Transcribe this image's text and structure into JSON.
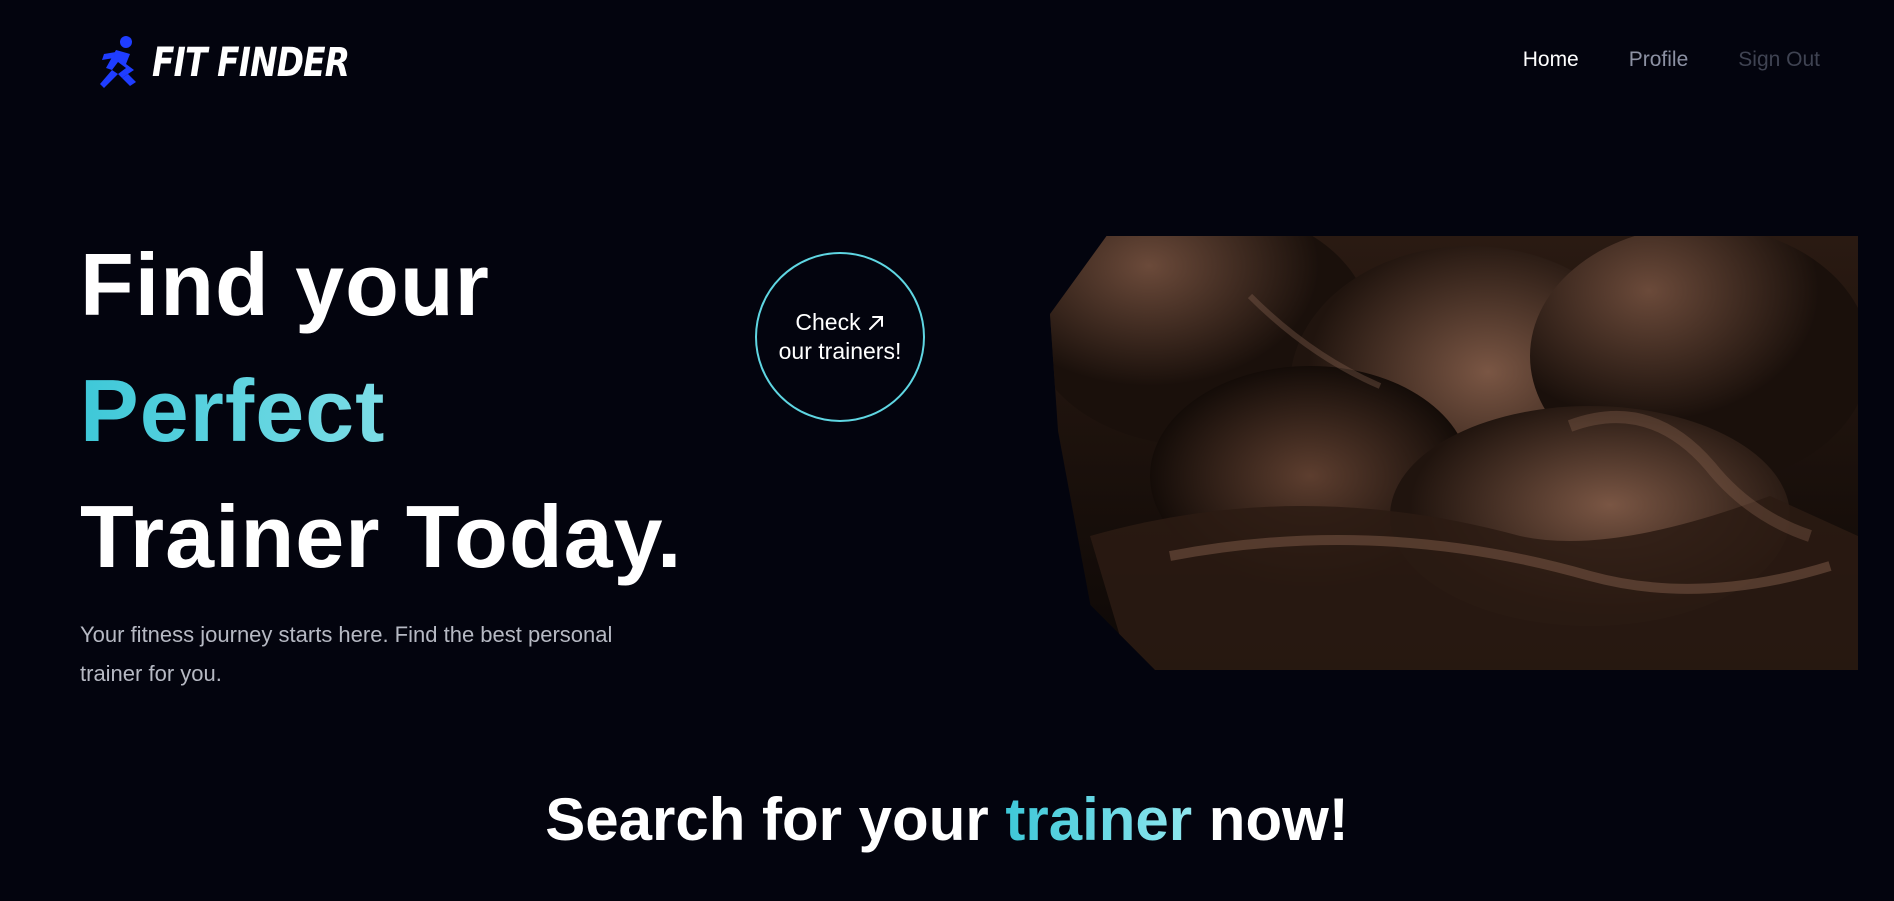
{
  "brand": {
    "name": "FIT FINDER",
    "icon": "running-figure-icon",
    "icon_color": "#1f3dff"
  },
  "nav": {
    "home": "Home",
    "profile": "Profile",
    "sign_out": "Sign Out"
  },
  "hero": {
    "title_line1": "Find your",
    "title_line2": "Perfect",
    "title_line3": "Trainer Today.",
    "subtitle": "Your fitness journey starts here. Find the best personal trainer for you.",
    "cta_line1": "Check",
    "cta_line2": "our trainers!",
    "cta_icon": "arrow-up-right-icon",
    "image_subject": "muscular-torso-image"
  },
  "search_section": {
    "title_prefix": "Search for your",
    "title_accent": "trainer",
    "title_suffix": "now!"
  },
  "colors": {
    "background": "#03040e",
    "accent": "#3ec8d8",
    "brand_blue": "#1f3dff",
    "nav_active": "#ffffff",
    "nav_muted": "#8c91a3",
    "nav_disabled": "#3f4352"
  }
}
